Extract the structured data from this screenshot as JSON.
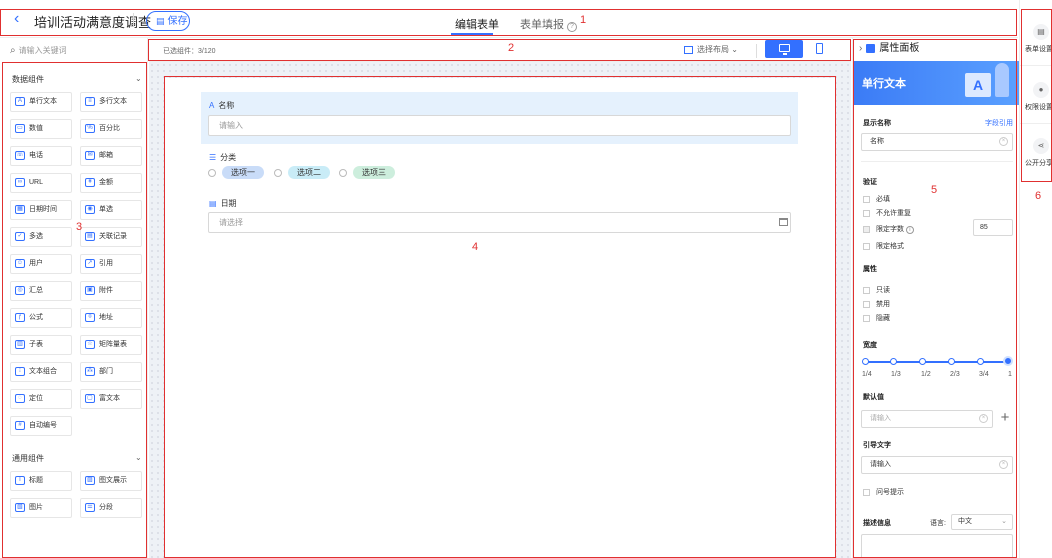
{
  "header": {
    "title": "培训活动满意度调查",
    "save_label": "保存",
    "tabs": [
      {
        "label": "编辑表单",
        "active": true
      },
      {
        "label": "表单填报",
        "active": false
      }
    ]
  },
  "annotations": [
    "1",
    "2",
    "3",
    "4",
    "5",
    "6"
  ],
  "left_panel": {
    "search_placeholder": "请输入关键词",
    "groups": [
      {
        "title": "数据组件",
        "items": [
          {
            "label": "单行文本",
            "icon": "text-single-icon"
          },
          {
            "label": "多行文本",
            "icon": "text-multi-icon"
          },
          {
            "label": "数值",
            "icon": "number-icon"
          },
          {
            "label": "百分比",
            "icon": "percent-icon"
          },
          {
            "label": "电话",
            "icon": "phone-icon"
          },
          {
            "label": "邮箱",
            "icon": "email-icon"
          },
          {
            "label": "URL",
            "icon": "link-icon"
          },
          {
            "label": "金额",
            "icon": "money-icon"
          },
          {
            "label": "日期时间",
            "icon": "calendar-icon"
          },
          {
            "label": "单选",
            "icon": "radio-icon"
          },
          {
            "label": "多选",
            "icon": "checkbox-icon"
          },
          {
            "label": "关联记录",
            "icon": "relation-icon"
          },
          {
            "label": "用户",
            "icon": "user-icon"
          },
          {
            "label": "引用",
            "icon": "quote-icon"
          },
          {
            "label": "汇总",
            "icon": "summary-icon"
          },
          {
            "label": "附件",
            "icon": "attachment-icon"
          },
          {
            "label": "公式",
            "icon": "formula-icon"
          },
          {
            "label": "地址",
            "icon": "location-pin-icon"
          },
          {
            "label": "子表",
            "icon": "subtable-icon"
          },
          {
            "label": "矩阵量表",
            "icon": "matrix-icon"
          },
          {
            "label": "文本组合",
            "icon": "text-combo-icon"
          },
          {
            "label": "部门",
            "icon": "department-icon"
          },
          {
            "label": "定位",
            "icon": "locate-icon"
          },
          {
            "label": "富文本",
            "icon": "richtext-icon"
          },
          {
            "label": "自动编号",
            "icon": "auto-number-icon"
          }
        ]
      },
      {
        "title": "通用组件",
        "items": [
          {
            "label": "标题",
            "icon": "heading-icon"
          },
          {
            "label": "图文展示",
            "icon": "image-text-icon"
          },
          {
            "label": "图片",
            "icon": "image-icon"
          },
          {
            "label": "分段",
            "icon": "section-icon"
          }
        ]
      }
    ]
  },
  "toolbar": {
    "selected_count_text": "已选组件：3/120",
    "layout_label": "选择布局",
    "device_active": "pc"
  },
  "form": {
    "fields": [
      {
        "type": "text",
        "icon_glyph": "A",
        "label": "名称",
        "placeholder": "请输入"
      },
      {
        "type": "radio",
        "icon_glyph": "☰",
        "label": "分类",
        "options": [
          {
            "label": "选项一",
            "color": "#c9dcf8"
          },
          {
            "label": "选项二",
            "color": "#c9ecf7"
          },
          {
            "label": "选项三",
            "color": "#cdeedd"
          }
        ]
      },
      {
        "type": "date",
        "icon_glyph": "▤",
        "label": "日期",
        "placeholder": "请选择"
      }
    ]
  },
  "property_panel": {
    "title": "属性面板",
    "component_name": "单行文本",
    "banner_glyph": "A",
    "display_name_label": "显示名称",
    "field_ref_link": "字段引用",
    "display_name_value": "名称",
    "validation_title": "验证",
    "validation_options": [
      "必填",
      "不允许重复",
      "限定字数",
      "限定格式"
    ],
    "char_limit_value": "85",
    "attributes_title": "属性",
    "attributes_options": [
      "只读",
      "禁用",
      "隐藏"
    ],
    "width_title": "宽度",
    "width_ticks": [
      "1/4",
      "1/3",
      "1/2",
      "2/3",
      "3/4",
      "1"
    ],
    "width_value": "1",
    "default_title": "默认值",
    "default_placeholder": "请输入",
    "guide_title": "引导文字",
    "guide_value": "请输入",
    "question_tip_label": "问号提示",
    "desc_title": "描述信息",
    "lang_label": "语言:",
    "lang_value": "中文"
  },
  "far_right": {
    "items": [
      {
        "label": "表单设置",
        "icon": "form-settings-icon"
      },
      {
        "label": "权限设置",
        "icon": "permission-icon"
      },
      {
        "label": "公开分享",
        "icon": "share-icon"
      }
    ]
  },
  "colors": {
    "accent": "#3370ff",
    "annotation": "#e03030",
    "field_highlight": "#e5f1fd"
  }
}
